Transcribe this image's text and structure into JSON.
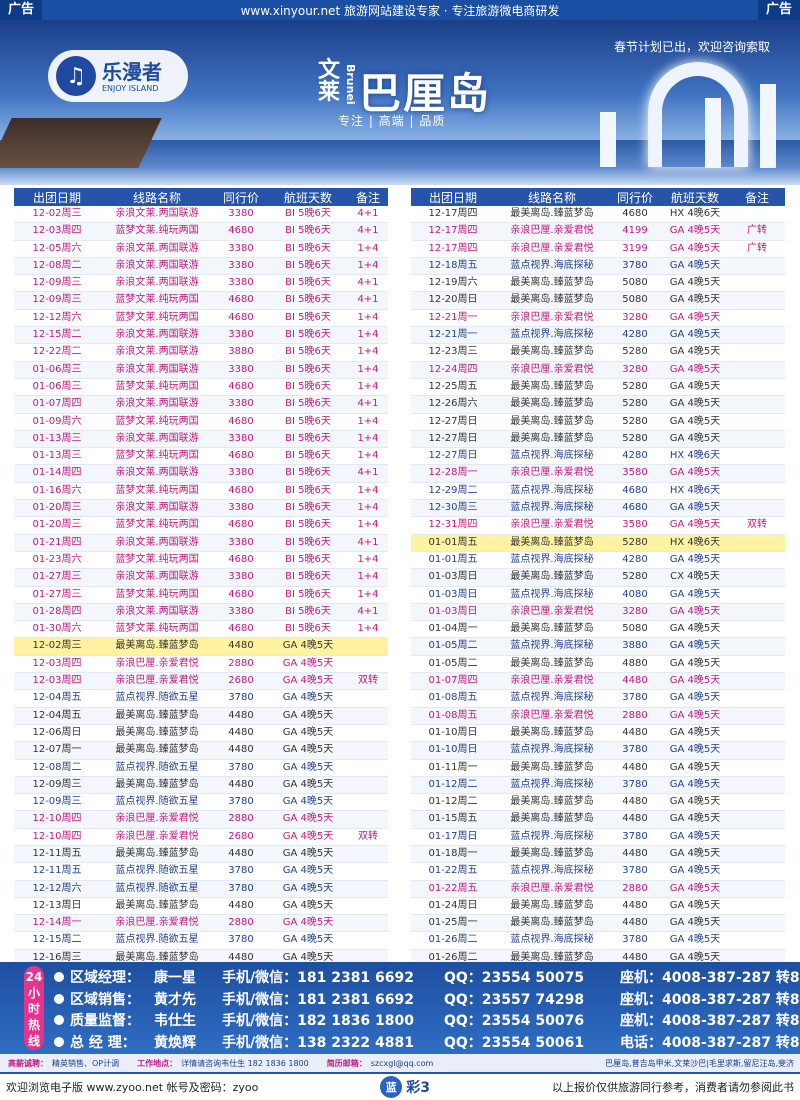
{
  "topbar": {
    "ad_left": "广告",
    "ad_right": "广告",
    "center_text": "www.xinyour.net 旅游网站建设专家 · 专注旅游微电商研发"
  },
  "banner": {
    "logo_cn": "乐漫者",
    "logo_en": "ENJOY ISLAND",
    "notice": "春节计划已出，欢迎咨询索取",
    "title_small": "文莱",
    "title_brunei": "Brunei",
    "title_main": "巴厘岛",
    "slogan": "专注 | 高端 | 品质"
  },
  "headers": [
    "出团日期",
    "线路名称",
    "同行价",
    "航班天数",
    "备注"
  ],
  "left_rows": [
    {
      "d": "12-02周三",
      "r": "亲浪文莱.两国联游",
      "p": "3380",
      "f": "BI 5晚6天",
      "n": "4+1",
      "c": "pink"
    },
    {
      "d": "12-03周四",
      "r": "蓝梦文莱.纯玩两国",
      "p": "4680",
      "f": "BI 5晚6天",
      "n": "4+1",
      "c": "pink"
    },
    {
      "d": "12-05周六",
      "r": "亲浪文莱.两国联游",
      "p": "3380",
      "f": "BI 5晚6天",
      "n": "1+4",
      "c": "pink"
    },
    {
      "d": "12-08周二",
      "r": "亲浪文莱.两国联游",
      "p": "3380",
      "f": "BI 5晚6天",
      "n": "1+4",
      "c": "pink"
    },
    {
      "d": "12-09周三",
      "r": "亲浪文莱.两国联游",
      "p": "3380",
      "f": "BI 5晚6天",
      "n": "4+1",
      "c": "pink"
    },
    {
      "d": "12-09周三",
      "r": "蓝梦文莱.纯玩两国",
      "p": "4680",
      "f": "BI 5晚6天",
      "n": "4+1",
      "c": "pink"
    },
    {
      "d": "12-12周六",
      "r": "蓝梦文莱.纯玩两国",
      "p": "4680",
      "f": "BI 5晚6天",
      "n": "1+4",
      "c": "pink"
    },
    {
      "d": "12-15周二",
      "r": "亲浪文莱.两国联游",
      "p": "3380",
      "f": "BI 5晚6天",
      "n": "1+4",
      "c": "pink"
    },
    {
      "d": "12-22周二",
      "r": "亲浪文莱.两国联游",
      "p": "3880",
      "f": "BI 5晚6天",
      "n": "1+4",
      "c": "pink"
    },
    {
      "d": "01-06周三",
      "r": "亲浪文莱.两国联游",
      "p": "3380",
      "f": "BI 5晚6天",
      "n": "1+4",
      "c": "pink"
    },
    {
      "d": "01-06周三",
      "r": "蓝梦文莱.纯玩两国",
      "p": "4680",
      "f": "BI 5晚6天",
      "n": "1+4",
      "c": "pink"
    },
    {
      "d": "01-07周四",
      "r": "亲浪文莱.两国联游",
      "p": "3380",
      "f": "BI 5晚6天",
      "n": "4+1",
      "c": "pink"
    },
    {
      "d": "01-09周六",
      "r": "蓝梦文莱.纯玩两国",
      "p": "4680",
      "f": "BI 5晚6天",
      "n": "1+4",
      "c": "pink"
    },
    {
      "d": "01-13周三",
      "r": "亲浪文莱.两国联游",
      "p": "3380",
      "f": "BI 5晚6天",
      "n": "1+4",
      "c": "pink"
    },
    {
      "d": "01-13周三",
      "r": "蓝梦文莱.纯玩两国",
      "p": "4680",
      "f": "BI 5晚6天",
      "n": "1+4",
      "c": "pink"
    },
    {
      "d": "01-14周四",
      "r": "亲浪文莱.两国联游",
      "p": "3380",
      "f": "BI 5晚6天",
      "n": "4+1",
      "c": "pink"
    },
    {
      "d": "01-16周六",
      "r": "蓝梦文莱.纯玩两国",
      "p": "4680",
      "f": "BI 5晚6天",
      "n": "1+4",
      "c": "pink"
    },
    {
      "d": "01-20周三",
      "r": "亲浪文莱.两国联游",
      "p": "3380",
      "f": "BI 5晚6天",
      "n": "1+4",
      "c": "pink"
    },
    {
      "d": "01-20周三",
      "r": "蓝梦文莱.纯玩两国",
      "p": "4680",
      "f": "BI 5晚6天",
      "n": "1+4",
      "c": "pink"
    },
    {
      "d": "01-21周四",
      "r": "亲浪文莱.两国联游",
      "p": "3380",
      "f": "BI 5晚6天",
      "n": "4+1",
      "c": "pink"
    },
    {
      "d": "01-23周六",
      "r": "蓝梦文莱.纯玩两国",
      "p": "4680",
      "f": "BI 5晚6天",
      "n": "1+4",
      "c": "pink"
    },
    {
      "d": "01-27周三",
      "r": "亲浪文莱.两国联游",
      "p": "3380",
      "f": "BI 5晚6天",
      "n": "1+4",
      "c": "pink"
    },
    {
      "d": "01-27周三",
      "r": "蓝梦文莱.纯玩两国",
      "p": "4680",
      "f": "BI 5晚6天",
      "n": "1+4",
      "c": "pink"
    },
    {
      "d": "01-28周四",
      "r": "亲浪文莱.两国联游",
      "p": "3380",
      "f": "BI 5晚6天",
      "n": "4+1",
      "c": "pink"
    },
    {
      "d": "01-30周六",
      "r": "蓝梦文莱.纯玩两国",
      "p": "4680",
      "f": "BI 5晚6天",
      "n": "1+4",
      "c": "pink"
    },
    {
      "d": "12-02周三",
      "r": "最美离岛.臻蓝梦岛",
      "p": "4480",
      "f": "GA 4晚5天",
      "n": "",
      "c": "black",
      "hl": true
    },
    {
      "d": "12-03周四",
      "r": "亲浪巴厘.亲爱君悦",
      "p": "2880",
      "f": "GA 4晚5天",
      "n": "",
      "c": "pink"
    },
    {
      "d": "12-03周四",
      "r": "亲浪巴厘.亲爱君悦",
      "p": "2680",
      "f": "GA 4晚5天",
      "n": "双转",
      "c": "pink"
    },
    {
      "d": "12-04周五",
      "r": "蓝点视界.随欲五星",
      "p": "3780",
      "f": "GA 4晚5天",
      "n": "",
      "c": "blue"
    },
    {
      "d": "12-04周五",
      "r": "最美离岛.臻蓝梦岛",
      "p": "4480",
      "f": "GA 4晚5天",
      "n": "",
      "c": "black"
    },
    {
      "d": "12-06周日",
      "r": "最美离岛.臻蓝梦岛",
      "p": "4480",
      "f": "GA 4晚5天",
      "n": "",
      "c": "black"
    },
    {
      "d": "12-07周一",
      "r": "最美离岛.臻蓝梦岛",
      "p": "4480",
      "f": "GA 4晚5天",
      "n": "",
      "c": "black"
    },
    {
      "d": "12-08周二",
      "r": "蓝点视界.随欲五星",
      "p": "3780",
      "f": "GA 4晚5天",
      "n": "",
      "c": "blue"
    },
    {
      "d": "12-09周三",
      "r": "最美离岛.臻蓝梦岛",
      "p": "4480",
      "f": "GA 4晚5天",
      "n": "",
      "c": "black"
    },
    {
      "d": "12-09周三",
      "r": "蓝点视界.随欲五星",
      "p": "3780",
      "f": "GA 4晚5天",
      "n": "",
      "c": "blue"
    },
    {
      "d": "12-10周四",
      "r": "亲浪巴厘.亲爱君悦",
      "p": "2880",
      "f": "GA 4晚5天",
      "n": "",
      "c": "pink"
    },
    {
      "d": "12-10周四",
      "r": "亲浪巴厘.亲爱君悦",
      "p": "2680",
      "f": "GA 4晚5天",
      "n": "双转",
      "c": "pink"
    },
    {
      "d": "12-11周五",
      "r": "最美离岛.臻蓝梦岛",
      "p": "4480",
      "f": "GA 4晚5天",
      "n": "",
      "c": "black"
    },
    {
      "d": "12-11周五",
      "r": "蓝点视界.随欲五星",
      "p": "3780",
      "f": "GA 4晚5天",
      "n": "",
      "c": "blue"
    },
    {
      "d": "12-12周六",
      "r": "蓝点视界.随欲五星",
      "p": "3780",
      "f": "GA 4晚5天",
      "n": "",
      "c": "blue"
    },
    {
      "d": "12-13周日",
      "r": "最美离岛.臻蓝梦岛",
      "p": "4480",
      "f": "GA 4晚5天",
      "n": "",
      "c": "black"
    },
    {
      "d": "12-14周一",
      "r": "亲浪巴厘.亲爱君悦",
      "p": "2880",
      "f": "GA 4晚5天",
      "n": "",
      "c": "pink"
    },
    {
      "d": "12-15周二",
      "r": "蓝点视界.随欲五星",
      "p": "3780",
      "f": "GA 4晚5天",
      "n": "",
      "c": "blue"
    },
    {
      "d": "12-16周三",
      "r": "最美离岛.臻蓝梦岛",
      "p": "4480",
      "f": "GA 4晚5天",
      "n": "",
      "c": "black"
    },
    {
      "d": "12-16周三",
      "r": "最美离岛.臻蓝梦岛",
      "p": "4980",
      "f": "GA 4晚5天",
      "n": "广直",
      "c": "black"
    },
    {
      "d": "12-17周四",
      "r": "亲浪巴厘.亲爱君悦",
      "p": "2880",
      "f": "GA 4晚5天",
      "n": "",
      "c": "pink"
    }
  ],
  "right_rows": [
    {
      "d": "12-17周四",
      "r": "最美离岛.臻蓝梦岛",
      "p": "4680",
      "f": "HX 4晚6天",
      "n": "",
      "c": "black"
    },
    {
      "d": "12-17周四",
      "r": "亲浪巴厘.亲爱君悦",
      "p": "4199",
      "f": "GA 4晚5天",
      "n": "广转",
      "c": "pink"
    },
    {
      "d": "12-17周四",
      "r": "亲浪巴厘.亲爱君悦",
      "p": "3199",
      "f": "GA 4晚5天",
      "n": "广转",
      "c": "pink"
    },
    {
      "d": "12-18周五",
      "r": "蓝点视界.海底探秘",
      "p": "3780",
      "f": "GA 4晚5天",
      "n": "",
      "c": "blue"
    },
    {
      "d": "12-19周六",
      "r": "最美离岛.臻蓝梦岛",
      "p": "5080",
      "f": "GA 4晚5天",
      "n": "",
      "c": "black"
    },
    {
      "d": "12-20周日",
      "r": "最美离岛.臻蓝梦岛",
      "p": "5080",
      "f": "GA 4晚5天",
      "n": "",
      "c": "black"
    },
    {
      "d": "12-21周一",
      "r": "亲浪巴厘.亲爱君悦",
      "p": "3280",
      "f": "GA 4晚5天",
      "n": "",
      "c": "pink"
    },
    {
      "d": "12-21周一",
      "r": "蓝点视界.海底探秘",
      "p": "4280",
      "f": "GA 4晚5天",
      "n": "",
      "c": "blue"
    },
    {
      "d": "12-23周三",
      "r": "最美离岛.臻蓝梦岛",
      "p": "5280",
      "f": "GA 4晚5天",
      "n": "",
      "c": "black"
    },
    {
      "d": "12-24周四",
      "r": "亲浪巴厘.亲爱君悦",
      "p": "3280",
      "f": "GA 4晚5天",
      "n": "",
      "c": "pink"
    },
    {
      "d": "12-25周五",
      "r": "最美离岛.臻蓝梦岛",
      "p": "5280",
      "f": "GA 4晚5天",
      "n": "",
      "c": "black"
    },
    {
      "d": "12-26周六",
      "r": "最美离岛.臻蓝梦岛",
      "p": "5280",
      "f": "GA 4晚5天",
      "n": "",
      "c": "black"
    },
    {
      "d": "12-27周日",
      "r": "最美离岛.臻蓝梦岛",
      "p": "5280",
      "f": "GA 4晚5天",
      "n": "",
      "c": "black"
    },
    {
      "d": "12-27周日",
      "r": "最美离岛.臻蓝梦岛",
      "p": "5280",
      "f": "GA 4晚5天",
      "n": "",
      "c": "black"
    },
    {
      "d": "12-27周日",
      "r": "蓝点视界.海底探秘",
      "p": "4280",
      "f": "HX 4晚6天",
      "n": "",
      "c": "blue"
    },
    {
      "d": "12-28周一",
      "r": "亲浪巴厘.亲爱君悦",
      "p": "3580",
      "f": "GA 4晚5天",
      "n": "",
      "c": "pink"
    },
    {
      "d": "12-29周二",
      "r": "蓝点视界.海底探秘",
      "p": "4680",
      "f": "HX 4晚6天",
      "n": "",
      "c": "blue"
    },
    {
      "d": "12-30周三",
      "r": "蓝点视界.海底探秘",
      "p": "4680",
      "f": "GA 4晚5天",
      "n": "",
      "c": "blue"
    },
    {
      "d": "12-31周四",
      "r": "亲浪巴厘.亲爱君悦",
      "p": "3580",
      "f": "GA 4晚5天",
      "n": "双转",
      "c": "pink"
    },
    {
      "d": "01-01周五",
      "r": "最美离岛.臻蓝梦岛",
      "p": "5280",
      "f": "HX 4晚6天",
      "n": "",
      "c": "black",
      "hl": true
    },
    {
      "d": "01-01周五",
      "r": "蓝点视界.海底探秘",
      "p": "4280",
      "f": "GA 4晚5天",
      "n": "",
      "c": "blue"
    },
    {
      "d": "01-03周日",
      "r": "最美离岛.臻蓝梦岛",
      "p": "5280",
      "f": "CX 4晚5天",
      "n": "",
      "c": "black"
    },
    {
      "d": "01-03周日",
      "r": "蓝点视界.海底探秘",
      "p": "4080",
      "f": "GA 4晚5天",
      "n": "",
      "c": "blue"
    },
    {
      "d": "01-03周日",
      "r": "亲浪巴厘.亲爱君悦",
      "p": "3280",
      "f": "GA 4晚5天",
      "n": "",
      "c": "pink"
    },
    {
      "d": "01-04周一",
      "r": "最美离岛.臻蓝梦岛",
      "p": "5080",
      "f": "GA 4晚5天",
      "n": "",
      "c": "black"
    },
    {
      "d": "01-05周二",
      "r": "蓝点视界.海底探秘",
      "p": "3880",
      "f": "GA 4晚5天",
      "n": "",
      "c": "blue"
    },
    {
      "d": "01-05周二",
      "r": "最美离岛.臻蓝梦岛",
      "p": "4880",
      "f": "GA 4晚5天",
      "n": "",
      "c": "black"
    },
    {
      "d": "01-07周四",
      "r": "亲浪巴厘.亲爱君悦",
      "p": "4480",
      "f": "GA 4晚5天",
      "n": "",
      "c": "pink"
    },
    {
      "d": "01-08周五",
      "r": "蓝点视界.海底探秘",
      "p": "3780",
      "f": "GA 4晚5天",
      "n": "",
      "c": "blue"
    },
    {
      "d": "01-08周五",
      "r": "亲浪巴厘.亲爱君悦",
      "p": "2880",
      "f": "GA 4晚5天",
      "n": "",
      "c": "pink"
    },
    {
      "d": "01-10周日",
      "r": "最美离岛.臻蓝梦岛",
      "p": "4480",
      "f": "GA 4晚5天",
      "n": "",
      "c": "black"
    },
    {
      "d": "01-10周日",
      "r": "蓝点视界.海底探秘",
      "p": "3780",
      "f": "GA 4晚5天",
      "n": "",
      "c": "blue"
    },
    {
      "d": "01-11周一",
      "r": "最美离岛.臻蓝梦岛",
      "p": "4480",
      "f": "GA 4晚5天",
      "n": "",
      "c": "black"
    },
    {
      "d": "01-12周二",
      "r": "蓝点视界.海底探秘",
      "p": "3780",
      "f": "GA 4晚5天",
      "n": "",
      "c": "blue"
    },
    {
      "d": "01-12周二",
      "r": "最美离岛.臻蓝梦岛",
      "p": "4480",
      "f": "GA 4晚5天",
      "n": "",
      "c": "black"
    },
    {
      "d": "01-15周五",
      "r": "最美离岛.臻蓝梦岛",
      "p": "4480",
      "f": "GA 4晚5天",
      "n": "",
      "c": "black"
    },
    {
      "d": "01-17周日",
      "r": "蓝点视界.海底探秘",
      "p": "3780",
      "f": "GA 4晚5天",
      "n": "",
      "c": "blue"
    },
    {
      "d": "01-18周一",
      "r": "最美离岛.臻蓝梦岛",
      "p": "4480",
      "f": "GA 4晚5天",
      "n": "",
      "c": "black"
    },
    {
      "d": "01-22周五",
      "r": "蓝点视界.海底探秘",
      "p": "3780",
      "f": "GA 4晚5天",
      "n": "",
      "c": "blue"
    },
    {
      "d": "01-22周五",
      "r": "亲浪巴厘.亲爱君悦",
      "p": "2880",
      "f": "GA 4晚5天",
      "n": "",
      "c": "pink"
    },
    {
      "d": "01-24周日",
      "r": "最美离岛.臻蓝梦岛",
      "p": "4480",
      "f": "GA 4晚5天",
      "n": "",
      "c": "black"
    },
    {
      "d": "01-25周一",
      "r": "最美离岛.臻蓝梦岛",
      "p": "4480",
      "f": "GA 4晚5天",
      "n": "",
      "c": "black"
    },
    {
      "d": "01-26周二",
      "r": "蓝点视界.海底探秘",
      "p": "3780",
      "f": "GA 4晚5天",
      "n": "",
      "c": "blue"
    },
    {
      "d": "01-26周二",
      "r": "最美离岛.臻蓝梦岛",
      "p": "4480",
      "f": "GA 4晚5天",
      "n": "",
      "c": "black"
    },
    {
      "d": "01-29周五",
      "r": "最美离岛.臻蓝梦岛",
      "p": "4680",
      "f": "GA 4晚5天",
      "n": "",
      "c": "black"
    },
    {
      "d": "01-31周日",
      "r": "最美离岛.臻蓝梦岛",
      "p": "4680",
      "f": "GA 4晚5天",
      "n": "",
      "c": "black"
    }
  ],
  "contact": {
    "vertical_label": "24小时热线",
    "rows": [
      {
        "role": "区域经理：",
        "name": "康一星",
        "phone": "手机/微信：181 2381 6692",
        "qq": "QQ：23554  50075",
        "tel": "座机：4008-387-287 转820"
      },
      {
        "role": "区域销售：",
        "name": "黄才先",
        "phone": "手机/微信：181 2381 6692",
        "qq": "QQ：23557  74298",
        "tel": "座机：4008-387-287 转820"
      },
      {
        "role": "质量监督：",
        "name": "韦仕生",
        "phone": "手机/微信：182 1836 1800",
        "qq": "QQ：23554  50076",
        "tel": "座机：4008-387-287 转814"
      },
      {
        "role": "总 经 理：",
        "name": "黄焕辉",
        "phone": "手机/微信：138 2322 4881",
        "qq": "QQ：23554  50061",
        "tel": "电话：4008-387-287 转803"
      }
    ]
  },
  "info": {
    "hire_label": "高薪诚聘：",
    "hire_text": "精英销售、OP计调",
    "work_label": "工作地点：",
    "work_text": "详情请咨询韦仕生 182 1836 1800",
    "mail_label": "简历邮箱：",
    "mail_text": "szcxgl@qq.com",
    "places": "巴厘岛,普吉岛甲米,文莱沙巴|毛里求斯,留尼汪岛,斐济"
  },
  "footer": {
    "left": "欢迎浏览电子版 www.zyoo.net  帐号及密码：zyoo",
    "circle": "蓝",
    "page": "彩3",
    "right": "以上报价仅供旅游同行参考，消费者请勿参阅此书"
  }
}
